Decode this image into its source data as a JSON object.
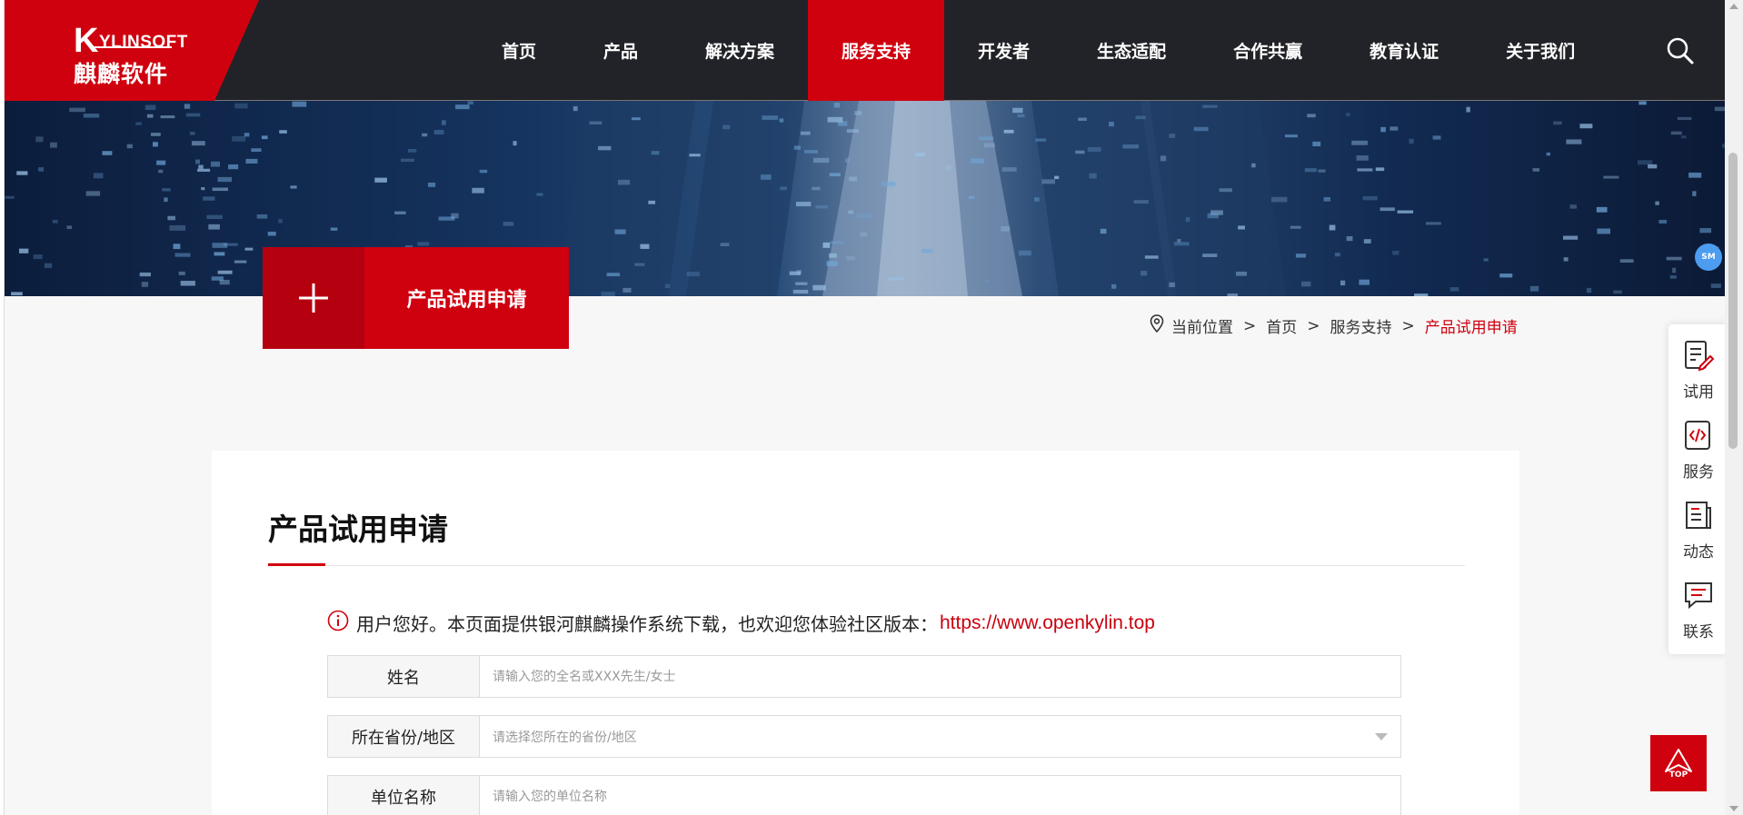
{
  "header": {
    "logo_en": "YLINSOFT",
    "logo_en_first": "K",
    "logo_cn": "麒麟软件",
    "nav": [
      {
        "label": "首页"
      },
      {
        "label": "产品"
      },
      {
        "label": "解决方案"
      },
      {
        "label": "服务支持",
        "active": true
      },
      {
        "label": "开发者"
      },
      {
        "label": "生态适配"
      },
      {
        "label": "合作共赢"
      },
      {
        "label": "教育认证"
      },
      {
        "label": "关于我们"
      }
    ],
    "search_icon": "search-icon"
  },
  "hero": {
    "tile_icon": "plus-icon",
    "tile_title": "产品试用申请"
  },
  "breadcrumb": {
    "icon": "location-pin-icon",
    "label": "当前位置",
    "items": [
      "首页",
      "服务支持"
    ],
    "current": "产品试用申请",
    "separator": ">"
  },
  "form": {
    "title": "产品试用申请",
    "notice": "用户您好。本页面提供银河麒麟操作系统下载，也欢迎您体验社区版本：",
    "notice_link": "https://www.openkylin.top",
    "fields": [
      {
        "label": "姓名",
        "placeholder": "请输入您的全名或XXX先生/女士",
        "type": "text"
      },
      {
        "label": "所在省份/地区",
        "placeholder": "请选择您所在的省份/地区",
        "type": "select"
      },
      {
        "label": "单位名称",
        "placeholder": "请输入您的单位名称",
        "type": "text"
      }
    ]
  },
  "side_tools": [
    {
      "label": "试用",
      "icon": "edit-document-icon"
    },
    {
      "label": "服务",
      "icon": "code-document-icon"
    },
    {
      "label": "动态",
      "icon": "news-document-icon"
    },
    {
      "label": "联系",
      "icon": "chat-message-icon"
    }
  ],
  "sm_badge": "SM",
  "top_button": "TOP",
  "colors": {
    "brand_red": "#d0010f",
    "header_bg": "#222328"
  }
}
